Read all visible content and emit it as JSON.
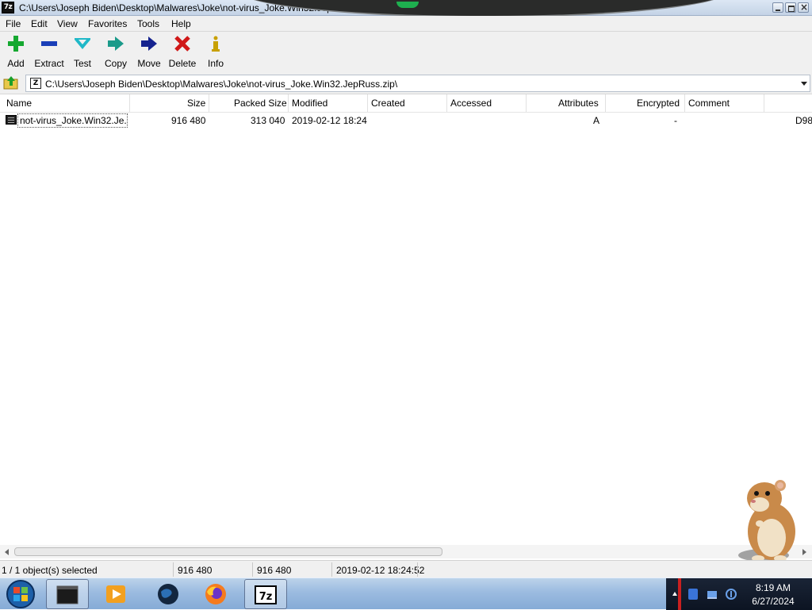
{
  "window": {
    "title": "C:\\Users\\Joseph Biden\\Desktop\\Malwares\\Joke\\not-virus_Joke.Win32.JepRuss.zip\\",
    "app_icon_text": "7z"
  },
  "menu": [
    "File",
    "Edit",
    "View",
    "Favorites",
    "Tools",
    "Help"
  ],
  "toolbar": {
    "buttons": [
      {
        "label": "Add",
        "icon": "plus-icon"
      },
      {
        "label": "Extract",
        "icon": "minus-icon"
      },
      {
        "label": "Test",
        "icon": "check-icon"
      },
      {
        "label": "Copy",
        "icon": "copy-arrow-icon"
      },
      {
        "label": "Move",
        "icon": "move-arrow-icon"
      },
      {
        "label": "Delete",
        "icon": "x-icon"
      },
      {
        "label": "Info",
        "icon": "info-icon"
      }
    ]
  },
  "address": {
    "path": "C:\\Users\\Joseph Biden\\Desktop\\Malwares\\Joke\\not-virus_Joke.Win32.JepRuss.zip\\",
    "icon_text": "Z"
  },
  "list": {
    "columns": [
      "Name",
      "Size",
      "Packed Size",
      "Modified",
      "Created",
      "Accessed",
      "Attributes",
      "Encrypted",
      "Comment"
    ],
    "rows": [
      {
        "name": "not-virus_Joke.Win32.Je...",
        "size": "916 480",
        "packed_size": "313 040",
        "modified": "2019-02-12 18:24",
        "created": "",
        "accessed": "",
        "attributes": "A",
        "encrypted": "-",
        "comment": "",
        "extra": "D98"
      }
    ]
  },
  "status": {
    "selection": "1 / 1 object(s) selected",
    "size": "916 480",
    "total": "916 480",
    "modified": "2019-02-12 18:24:52"
  },
  "taskbar": {
    "apps": [
      "terminal-icon",
      "media-player-icon",
      "globe-icon",
      "firefox-icon",
      "7zip-icon"
    ],
    "active": "7zip-icon",
    "clock_time": "8:19 AM",
    "clock_date": "6/27/2024"
  },
  "colors": {
    "add_green": "#15a830",
    "extract_blue": "#1a3fb8",
    "test_cyan": "#1fb8c8",
    "copy_teal": "#1a9a8a",
    "move_navy": "#15238f",
    "delete_red": "#d01818",
    "info_gold": "#c8a000"
  }
}
